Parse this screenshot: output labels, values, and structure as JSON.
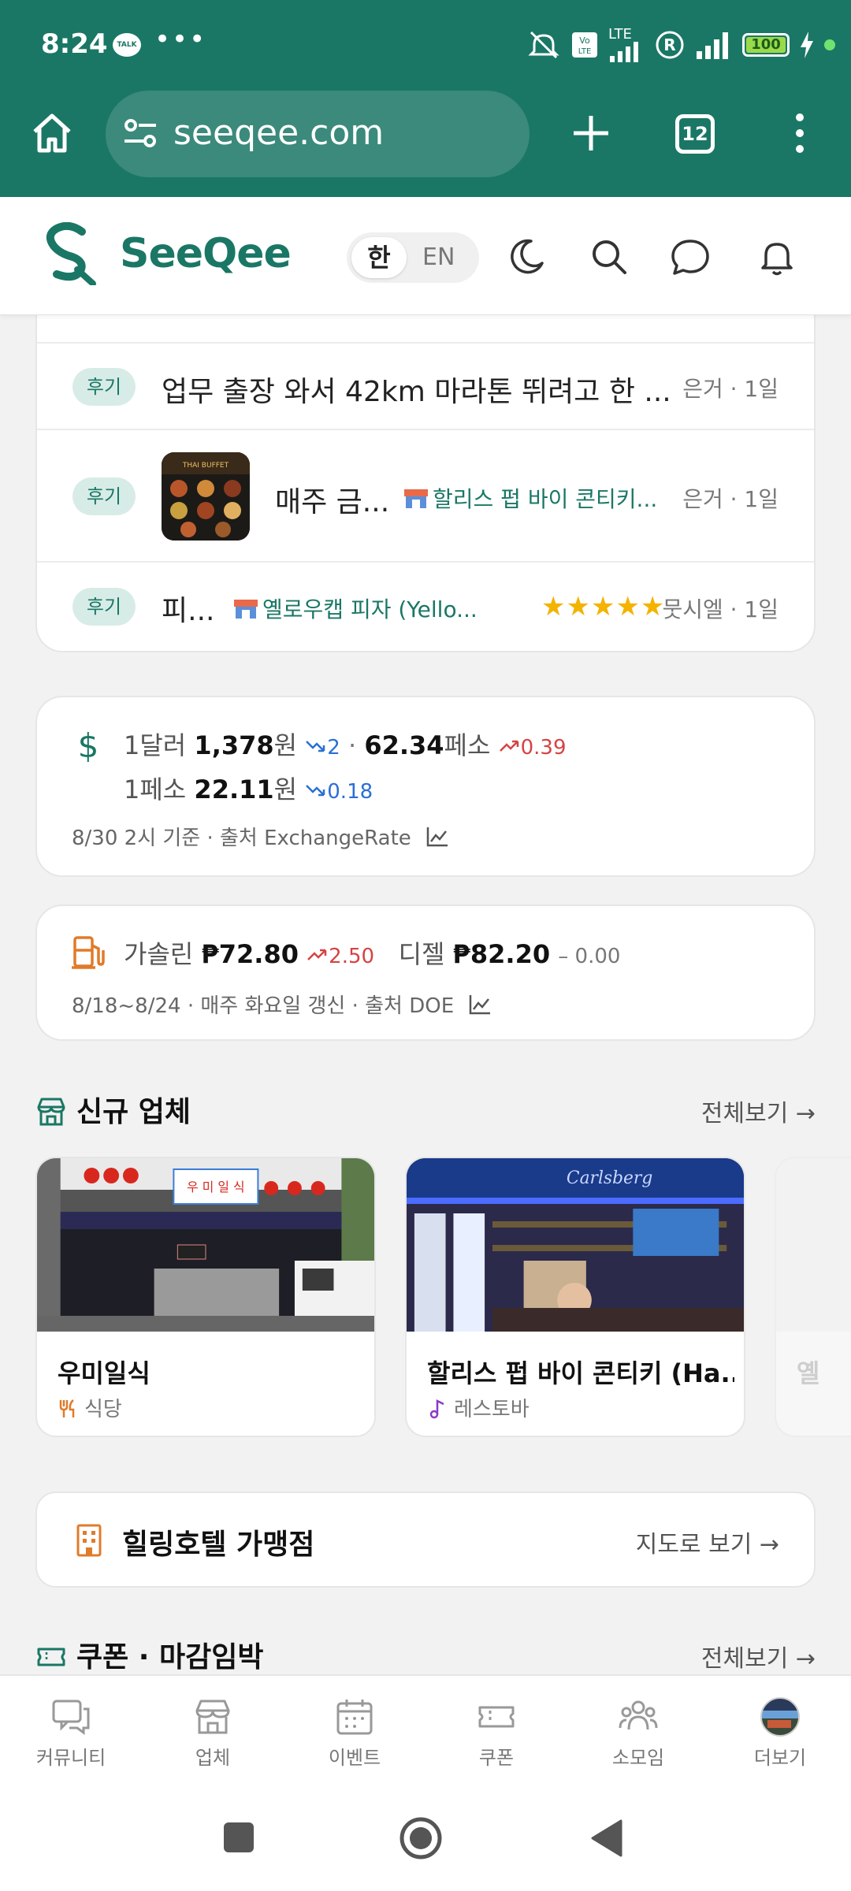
{
  "status_bar": {
    "time": "8:24",
    "talk_badge": "TALK",
    "more": "•••",
    "network": "LTE",
    "battery": "100",
    "icons": [
      "mute-icon",
      "volte-icon",
      "signal-icon",
      "roaming-icon",
      "signal-icon",
      "charging-icon"
    ]
  },
  "browser": {
    "url": "seeqee.com",
    "tab_count": "12",
    "icons": [
      "home-icon",
      "site-settings-icon",
      "plus-icon",
      "tabs-icon",
      "menu-icon"
    ]
  },
  "header": {
    "brand": "SeeQee",
    "lang_ko": "한",
    "lang_en": "EN",
    "icons": [
      "dark-mode-icon",
      "search-icon",
      "chat-icon",
      "bell-icon"
    ]
  },
  "reviews": [
    {
      "tag": "후기",
      "title": "업무 출장 와서 42km 마라톤 뛰려고 한 ...",
      "meta": "은거 · 1일"
    },
    {
      "tag": "후기",
      "title": "매주 금...",
      "place": "할리스 펍 바이 콘티키...",
      "meta": "은거 · 1일",
      "thumb_text": "THAI BUFFET"
    },
    {
      "tag": "후기",
      "title": "피...",
      "place": "옐로우캡 피자 (Yello...",
      "stars": 5,
      "meta": "뭇시엘 · 1일"
    }
  ],
  "exchange": {
    "line1_a_label": "1달러",
    "line1_a_value": "1,378",
    "line1_a_unit": "원",
    "line1_a_change": "2",
    "sep": "·",
    "line1_b_value": "62.34",
    "line1_b_unit": "페소",
    "line1_b_change": "0.39",
    "line2_label": "1페소",
    "line2_value": "22.11",
    "line2_unit": "원",
    "line2_change": "0.18",
    "footer": "8/30 2시 기준 · 출처 ExchangeRate",
    "icon": "dollar-icon"
  },
  "fuel": {
    "gasoline_label": "가솔린",
    "gasoline_value": "₱72.80",
    "gasoline_change": "2.50",
    "diesel_label": "디젤",
    "diesel_value": "₱82.20",
    "diesel_change": "– 0.00",
    "footer": "8/18~8/24 · 매주 화요일 갱신 · 출처 DOE",
    "icon": "fuel-pump-icon"
  },
  "new_businesses": {
    "title": "신규 업체",
    "see_all": "전체보기 →",
    "items": [
      {
        "name": "우미일식",
        "category": "식당",
        "sign": "우 미 일 식"
      },
      {
        "name": "할리스 펍 바이 콘티키 (Ha...",
        "category": "레스토바",
        "sign": "Carlsberg"
      },
      {
        "name": "옐",
        "category": ""
      }
    ]
  },
  "hotel": {
    "title": "힐링호텔 가맹점",
    "link": "지도로 보기 →"
  },
  "coupons": {
    "title": "쿠폰 · 마감임박",
    "see_all": "전체보기 →"
  },
  "bottom_nav": [
    {
      "label": "커뮤니티",
      "icon": "community-icon"
    },
    {
      "label": "업체",
      "icon": "store-icon"
    },
    {
      "label": "이벤트",
      "icon": "calendar-icon"
    },
    {
      "label": "쿠폰",
      "icon": "ticket-icon"
    },
    {
      "label": "소모임",
      "icon": "group-icon"
    },
    {
      "label": "더보기",
      "icon": "avatar"
    }
  ],
  "colors": {
    "brand": "#1a7765",
    "tag_bg": "#d8ece7",
    "down": "#2b6fd4",
    "up": "#d64343",
    "star": "#f3b300",
    "fuel_icon": "#e07b2a"
  }
}
